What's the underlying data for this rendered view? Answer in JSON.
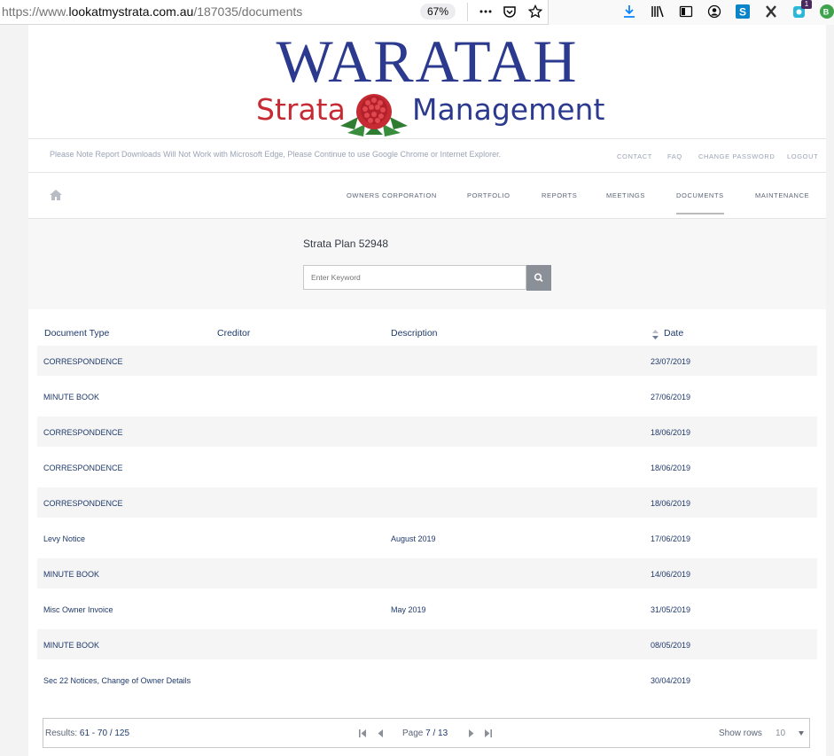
{
  "browser": {
    "url_prefix": "https://www.",
    "url_domain": "lookatmystrata.com.au",
    "url_path": "/187035/documents",
    "zoom": "67%",
    "badge_count": "1"
  },
  "logo": {
    "wordmark": "WARATAH",
    "sub_left": "Strata",
    "sub_right": "Management"
  },
  "notice": "Please Note Report Downloads Will Not Work with Microsoft Edge, Please Continue to use Google Chrome or Internet Explorer.",
  "util_links": [
    "CONTACT",
    "FAQ",
    "CHANGE PASSWORD",
    "LOGOUT"
  ],
  "nav": [
    "OWNERS CORPORATION",
    "PORTFOLIO",
    "REPORTS",
    "MEETINGS",
    "DOCUMENTS",
    "MAINTENANCE"
  ],
  "nav_active": "DOCUMENTS",
  "plan_title": "Strata Plan 52948",
  "search": {
    "placeholder": "Enter Keyword"
  },
  "table": {
    "headers": [
      "Document Type",
      "Creditor",
      "Description",
      "Date"
    ],
    "rows": [
      {
        "type": "CORRESPONDENCE",
        "creditor": "",
        "description": "",
        "date": "23/07/2019"
      },
      {
        "type": "MINUTE BOOK",
        "creditor": "",
        "description": "",
        "date": "27/06/2019"
      },
      {
        "type": "CORRESPONDENCE",
        "creditor": "",
        "description": "",
        "date": "18/06/2019"
      },
      {
        "type": "CORRESPONDENCE",
        "creditor": "",
        "description": "",
        "date": "18/06/2019"
      },
      {
        "type": "CORRESPONDENCE",
        "creditor": "",
        "description": "",
        "date": "18/06/2019"
      },
      {
        "type": "Levy Notice",
        "creditor": "",
        "description": "August 2019",
        "date": "17/06/2019"
      },
      {
        "type": "MINUTE BOOK",
        "creditor": "",
        "description": "",
        "date": "14/06/2019"
      },
      {
        "type": "Misc Owner Invoice",
        "creditor": "",
        "description": "May 2019",
        "date": "31/05/2019"
      },
      {
        "type": "MINUTE BOOK",
        "creditor": "",
        "description": "",
        "date": "08/05/2019"
      },
      {
        "type": "Sec 22 Notices, Change of Owner Details",
        "creditor": "",
        "description": "",
        "date": "30/04/2019"
      }
    ]
  },
  "pager": {
    "results_label": "Results:",
    "results_value": "61 - 70 / 125",
    "page_label": "Page",
    "page_value": "7 / 13",
    "rows_label": "Show rows",
    "rows_value": "10"
  },
  "colors": {
    "link": "#1f3a6b",
    "logo_blue": "#2b3a8e",
    "logo_red": "#c62a33",
    "row_stripe": "#f5f5f5",
    "search_button": "#8a8f98"
  }
}
